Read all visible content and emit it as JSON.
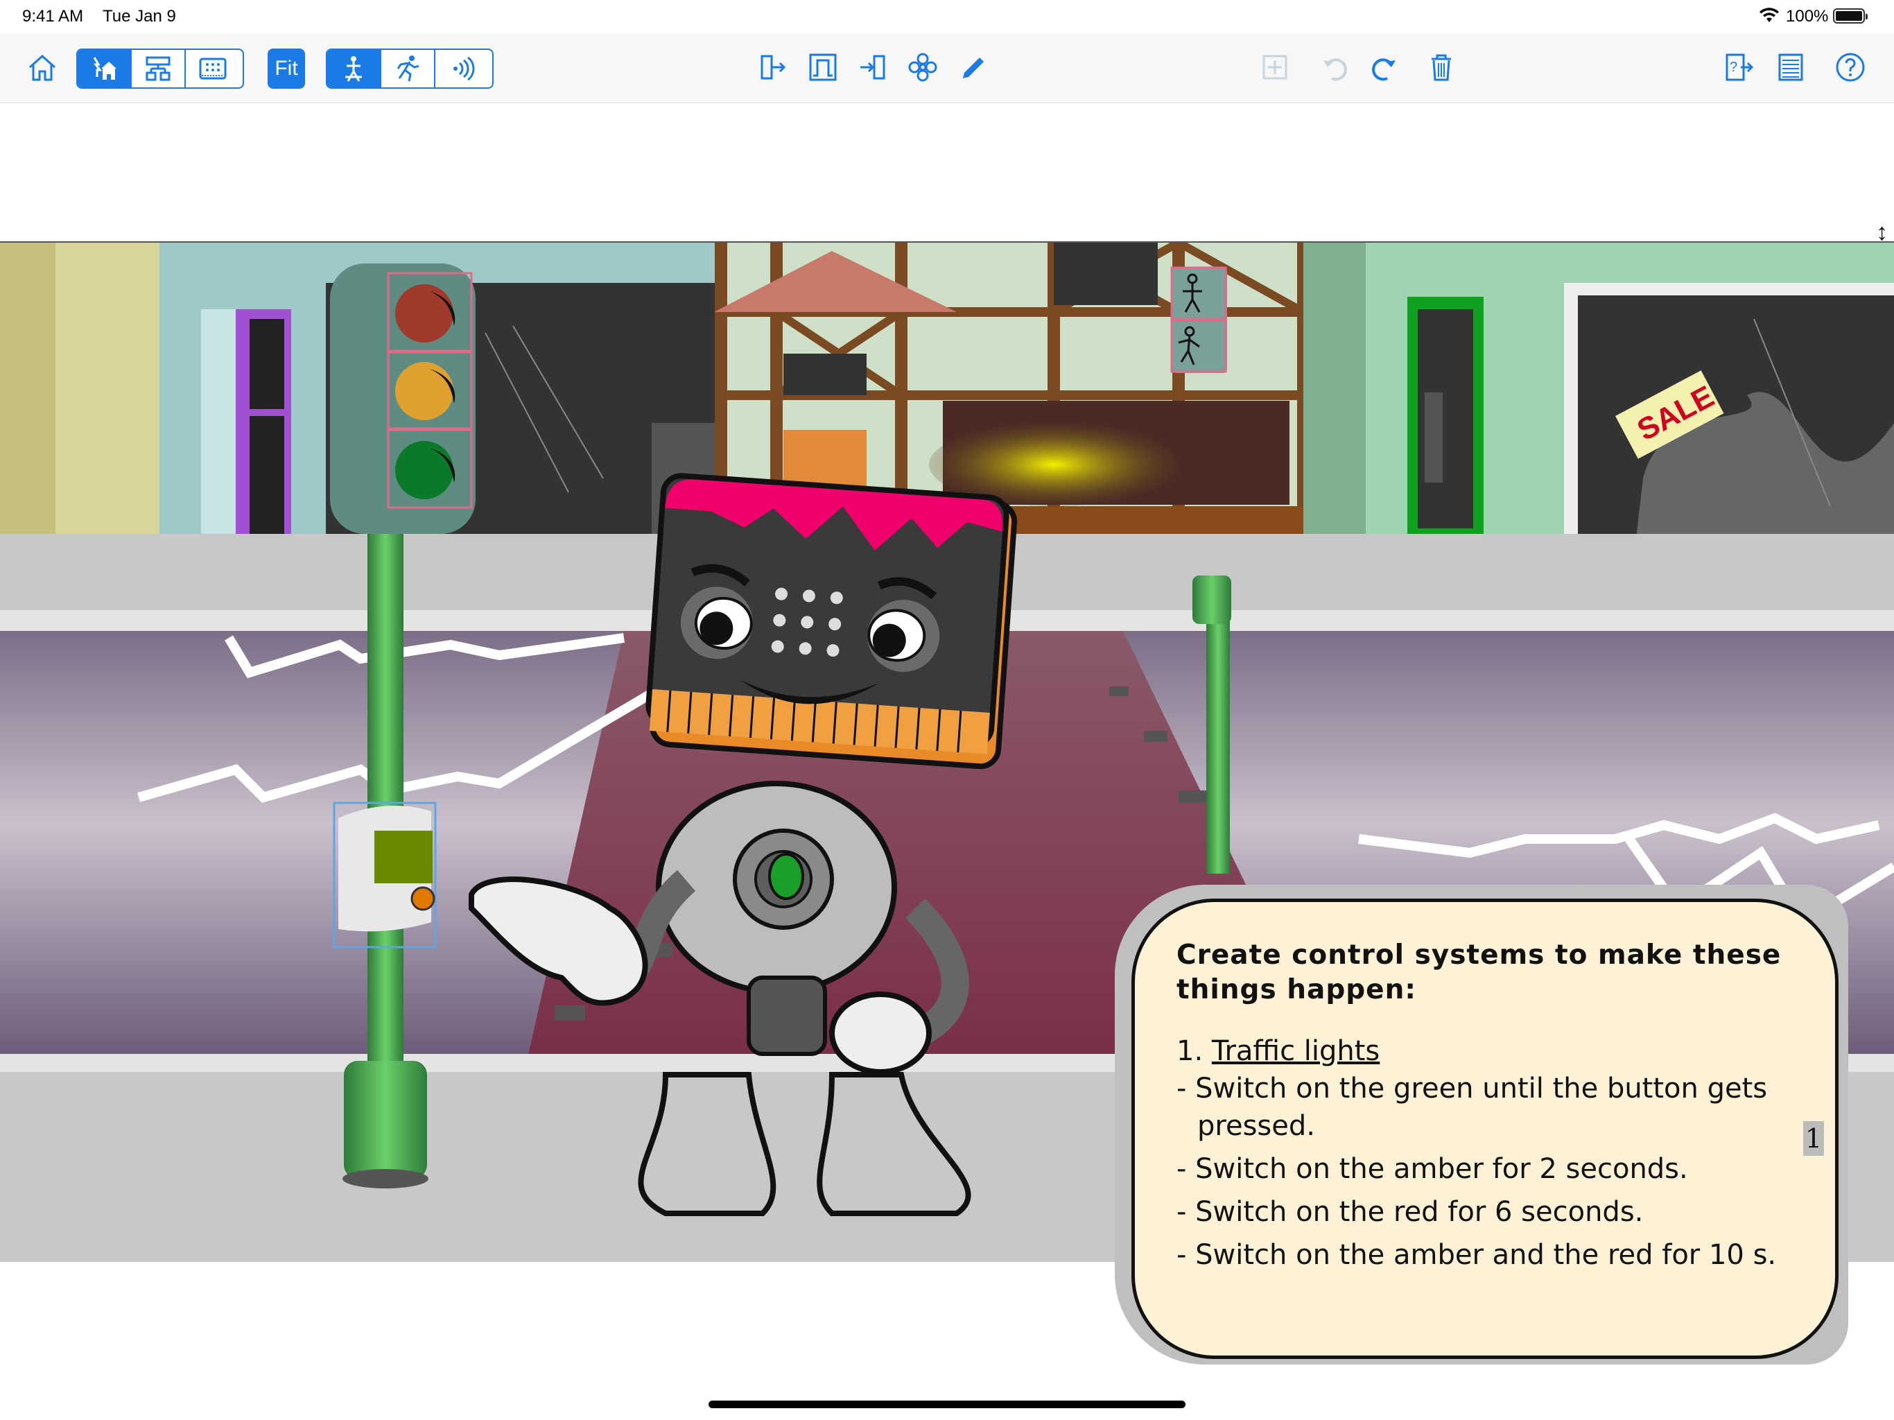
{
  "status_bar": {
    "time": "9:41 AM",
    "date": "Tue Jan 9",
    "battery": "100%",
    "battery_level": 1.0
  },
  "toolbar": {
    "fit_label": "Fit",
    "left_icons": [
      "home-icon",
      "level-scene-icon",
      "flowchart-icon",
      "microbit-icon"
    ],
    "mode_icons": [
      "simulate-icon",
      "run-icon",
      "broadcast-icon"
    ],
    "center_icons": [
      "output-icon",
      "pulse-icon",
      "input-icon",
      "sub-procedure-icon",
      "pencil-icon"
    ],
    "edit_icons": [
      "add-block-icon",
      "undo-icon",
      "redo-icon",
      "trash-icon"
    ],
    "right_icons": [
      "help-link-icon",
      "list-icon",
      "help-icon"
    ],
    "accent_color": "#1a7be6"
  },
  "scene": {
    "sale_sign": "SALE",
    "colors": {
      "road": "#8a7892",
      "crossing": "#7a4050",
      "pavement": "#c8c8c8",
      "sky_building": "#9cc8c8"
    }
  },
  "card": {
    "heading": "Create control systems to make these things happen:",
    "section_num": "1.",
    "section_title": "Traffic lights",
    "lines": [
      "- Switch on the green until the button gets pressed.",
      "- Switch on the amber for 2 seconds.",
      "- Switch on the red for 6 seconds.",
      "- Switch on the amber and the red for 10 s."
    ],
    "page": "1"
  }
}
